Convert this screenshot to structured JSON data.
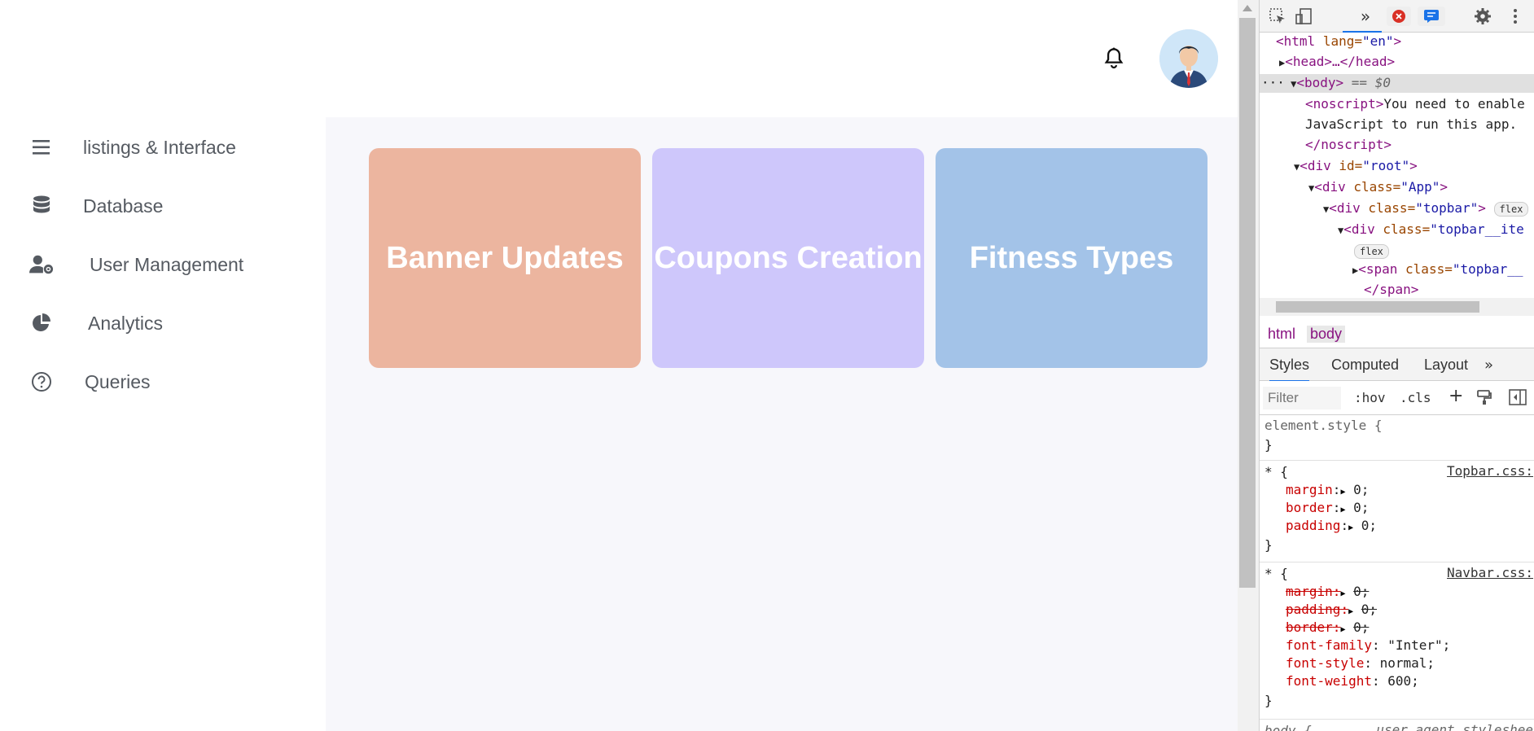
{
  "sidebar": {
    "items": [
      {
        "label": "listings & Interface",
        "icon": "menu-icon"
      },
      {
        "label": "Database",
        "icon": "database-icon"
      },
      {
        "label": "User Management",
        "icon": "user-gear-icon"
      },
      {
        "label": "Analytics",
        "icon": "pie-chart-icon"
      },
      {
        "label": "Queries",
        "icon": "question-circle-icon"
      }
    ]
  },
  "topbar": {
    "notification_icon": "bell-icon",
    "avatar_icon": "avatar-icon"
  },
  "cards": [
    {
      "label": "Banner Updates",
      "color": "#ecb59f"
    },
    {
      "label": "Coupons Creation",
      "color": "#cec7fb"
    },
    {
      "label": "Fitness Types",
      "color": "#a3c3e8"
    }
  ],
  "devtools": {
    "dom": {
      "l1_tag": "<html",
      "l1_attr": "lang=",
      "l1_val": "\"en\"",
      "l1_end": ">",
      "l2": "<head>…</head>",
      "l3_tag": "<body>",
      "l3_eq": " == $0",
      "l4": "<noscript>",
      "l4_txt": "You need to enable",
      "l5_txt": "JavaScript to run this app.",
      "l6": "</noscript>",
      "l7_tag": "<div",
      "l7_attr": " id=",
      "l7_val": "\"root\"",
      "l7_end": ">",
      "l8_tag": "<div",
      "l8_attr": " class=",
      "l8_val": "\"App\"",
      "l8_end": ">",
      "l9_tag": "<div",
      "l9_attr": " class=",
      "l9_val": "\"topbar\"",
      "l9_end": ">",
      "l9_badge": "flex",
      "l10_tag": "<div",
      "l10_attr": " class=",
      "l10_val": "\"topbar__ite",
      "l11_badge": "flex",
      "l12_tag": "<span",
      "l12_attr": " class=",
      "l12_val": "\"topbar__",
      "l13": "</span>",
      "dots": "···"
    },
    "crumbs": [
      "html",
      "body"
    ],
    "tabs": [
      "Styles",
      "Computed",
      "Layout"
    ],
    "more_tabs": "»",
    "filter_placeholder": "Filter",
    "hov": ":hov",
    "cls": ".cls",
    "plus": "+",
    "styles": {
      "element_style": "element.style {",
      "close": "}",
      "rule1_sel": "* {",
      "rule1_src": "Topbar.css:",
      "rule1_props": [
        {
          "name": "margin",
          "value": "0;"
        },
        {
          "name": "border",
          "value": "0;"
        },
        {
          "name": "padding",
          "value": "0;"
        }
      ],
      "rule2_sel": "* {",
      "rule2_src": "Navbar.css:",
      "rule2_struck": [
        {
          "name": "margin",
          "value": "0;"
        },
        {
          "name": "padding",
          "value": "0;"
        },
        {
          "name": "border",
          "value": "0;"
        }
      ],
      "rule2_props": [
        {
          "name": "font-family",
          "value": "\"Inter\";"
        },
        {
          "name": "font-style",
          "value": "normal;"
        },
        {
          "name": "font-weight",
          "value": "600;"
        }
      ],
      "body_sel": "body {",
      "body_src": "user agent styleshee"
    }
  }
}
